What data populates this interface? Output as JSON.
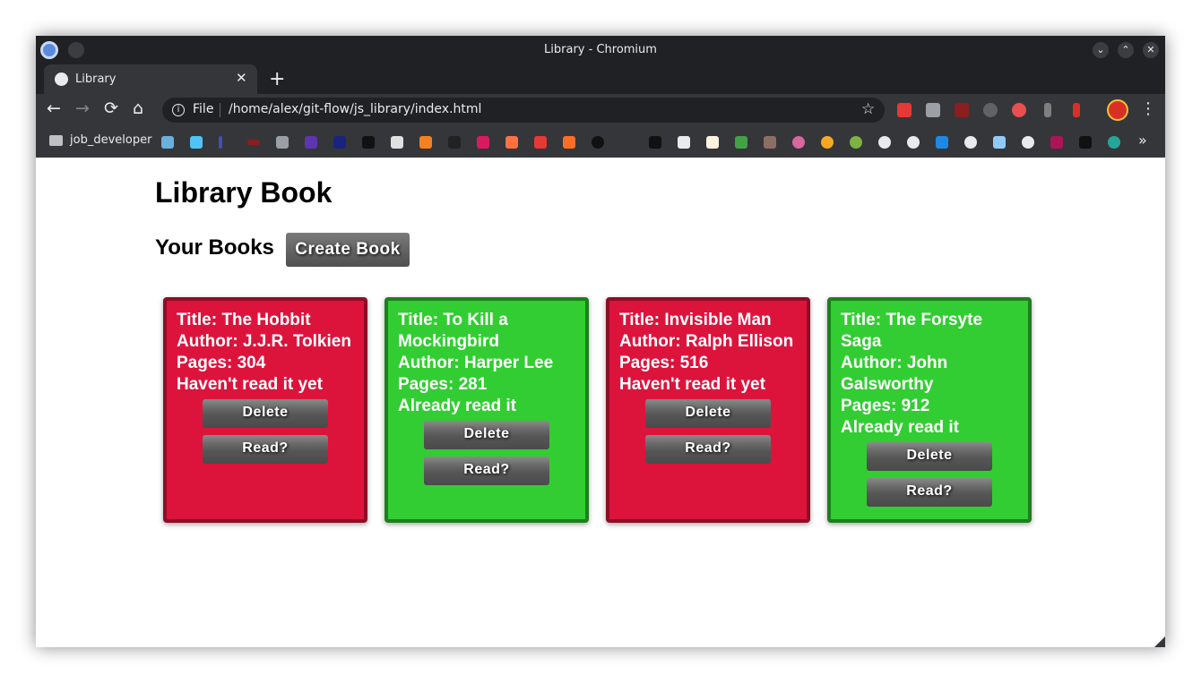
{
  "window": {
    "title": "Library - Chromium"
  },
  "tabs": [
    {
      "label": "Library",
      "close_glyph": "✕"
    }
  ],
  "newtab_glyph": "+",
  "toolbar": {
    "back_glyph": "←",
    "forward_glyph": "→",
    "reload_glyph": "⟳",
    "home_glyph": "⌂",
    "scheme": "File",
    "url": "/home/alex/git-flow/js_library/index.html",
    "star_glyph": "☆",
    "menu_glyph": "⋮"
  },
  "bookmarks": {
    "folder": "job_developer",
    "more_glyph": "»"
  },
  "page": {
    "title": "Library Book",
    "section_title": "Your Books",
    "create_button": "Create Book"
  },
  "books": [
    {
      "title": "Title: The Hobbit",
      "author": "Author: J.J.R. Tolkien",
      "pages": "Pages: 304",
      "status": "Haven't read it yet",
      "delete_label": "Delete",
      "read_label": "Read?",
      "state": "unread"
    },
    {
      "title": "Title: To Kill a Mockingbird",
      "author": "Author: Harper Lee",
      "pages": "Pages: 281",
      "status": "Already read it",
      "delete_label": "Delete",
      "read_label": "Read?",
      "state": "read"
    },
    {
      "title": "Title: Invisible Man",
      "author": "Author: Ralph Ellison",
      "pages": "Pages: 516",
      "status": "Haven't read it yet",
      "delete_label": "Delete",
      "read_label": "Read?",
      "state": "unread"
    },
    {
      "title": "Title: The Forsyte Saga",
      "author": "Author: John Galsworthy",
      "pages": "Pages: 912",
      "status": "Already read it",
      "delete_label": "Delete",
      "read_label": "Read?",
      "state": "read"
    }
  ],
  "colors": {
    "unread": "#dc143c",
    "read": "#32cd32",
    "button": "#5a5a5a"
  }
}
